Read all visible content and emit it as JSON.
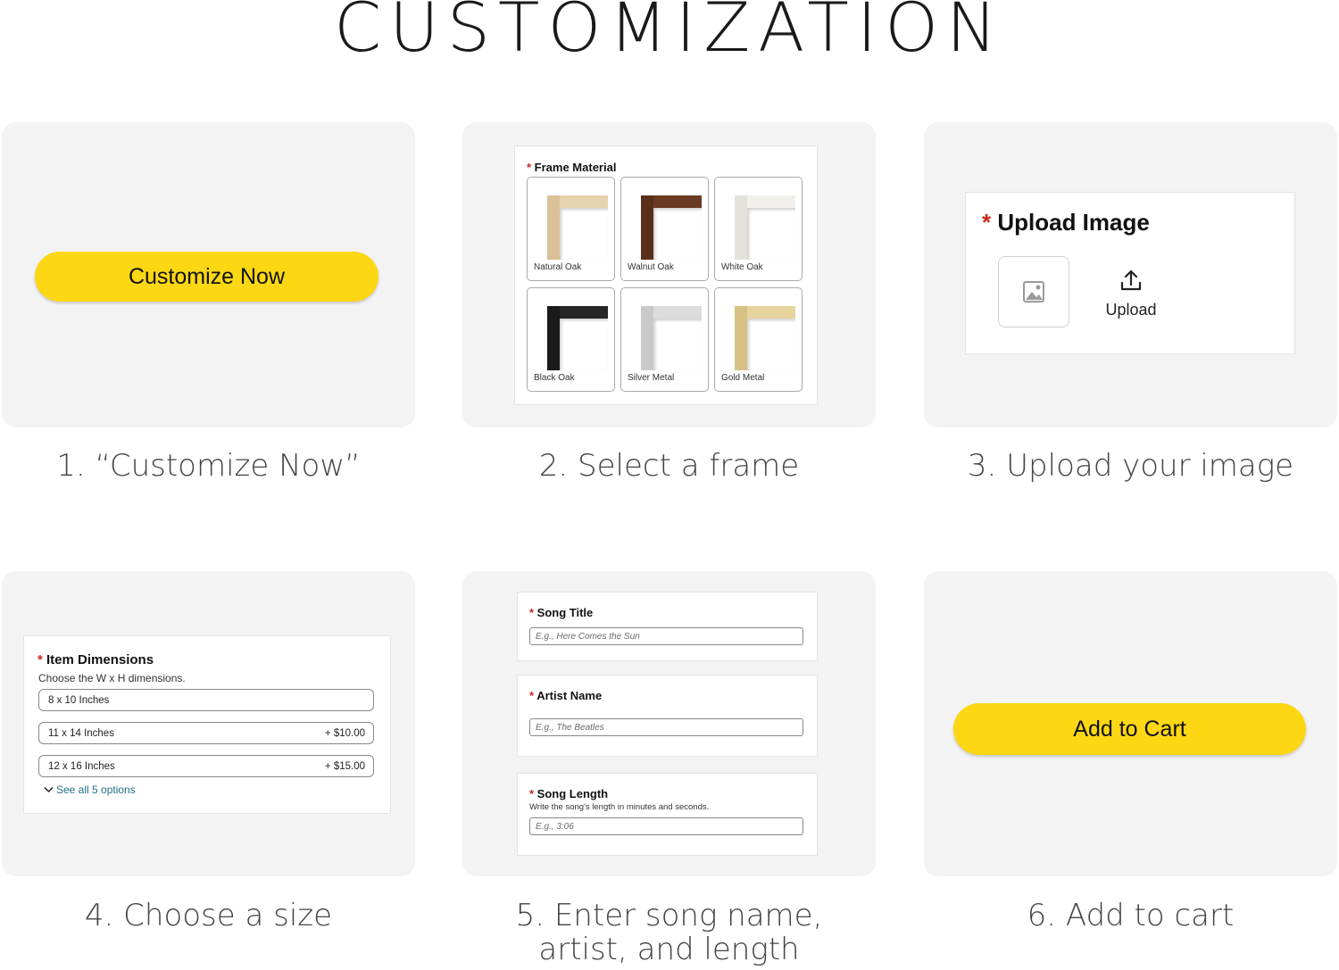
{
  "page": {
    "title": "CUSTOMIZATION"
  },
  "step1": {
    "button_label": "Customize Now",
    "caption": "1. “Customize Now”"
  },
  "step2": {
    "label": "Frame Material",
    "frames": [
      {
        "name": "Natural Oak",
        "color_top": "#e7d3b0",
        "color_left": "#d9c098"
      },
      {
        "name": "Walnut Oak",
        "color_top": "#6a3b22",
        "color_left": "#5a2f1a"
      },
      {
        "name": "White Oak",
        "color_top": "#f1f0ec",
        "color_left": "#e4e2dc"
      },
      {
        "name": "Black Oak",
        "color_top": "#262626",
        "color_left": "#1a1a1a"
      },
      {
        "name": "Silver Metal",
        "color_top": "#dcdcdc",
        "color_left": "#c9c9c9"
      },
      {
        "name": "Gold Metal",
        "color_top": "#e7d39e",
        "color_left": "#d8c184"
      }
    ],
    "caption": "2. Select a frame"
  },
  "step3": {
    "label": "Upload Image",
    "upload_label": "Upload",
    "caption": "3. Upload your image"
  },
  "step4": {
    "label": "Item Dimensions",
    "hint": "Choose the W x H dimensions.",
    "options": [
      {
        "size": "8 x 10 Inches",
        "price": ""
      },
      {
        "size": "11 x 14 Inches",
        "price": "+ $10.00"
      },
      {
        "size": "12 x 16 Inches",
        "price": "+ $15.00"
      }
    ],
    "see_all": "See all 5 options",
    "caption": "4. Choose a size"
  },
  "step5": {
    "song_title": {
      "label": "Song Title",
      "placeholder": "E.g., Here Comes the Sun"
    },
    "artist_name": {
      "label": "Artist Name",
      "placeholder": "E.g., The Beatles"
    },
    "song_length": {
      "label": "Song Length",
      "hint": "Write the song's length in minutes and seconds.",
      "placeholder": "E.g., 3:06"
    },
    "caption_line1": "5. Enter song name,",
    "caption_line2": "artist, and length"
  },
  "step6": {
    "button_label": "Add to Cart",
    "caption": "6. Add to cart"
  },
  "colors": {
    "button_yellow": "#fdd713",
    "card_bg": "#f3f3f3",
    "required_red": "#c7281c",
    "link_blue": "#1f6f86"
  }
}
